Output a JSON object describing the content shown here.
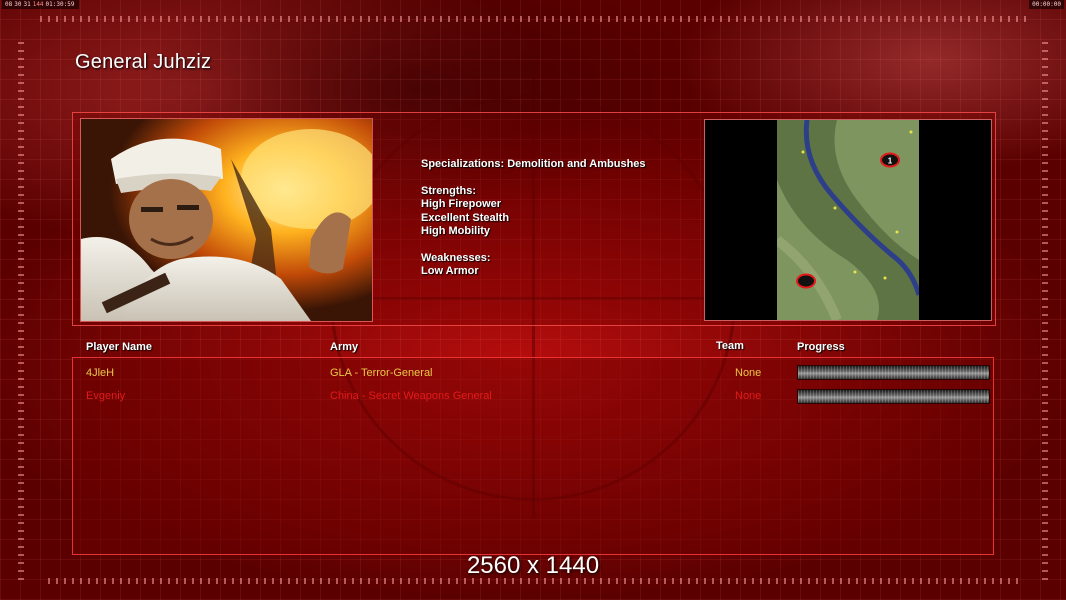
{
  "clock": {
    "left_segments": [
      "08",
      "30",
      "31",
      "144",
      "01:30:59"
    ],
    "right": "00:00:00"
  },
  "title": "General Juhziz",
  "briefing": {
    "specializations": "Specializations: Demolition and Ambushes",
    "strengths_header": "Strengths:",
    "strengths": [
      "High Firepower",
      "Excellent Stealth",
      "High Mobility"
    ],
    "weaknesses_header": "Weaknesses:",
    "weaknesses": [
      "Low Armor"
    ]
  },
  "minimap": {
    "start_markers": [
      {
        "label": "1"
      },
      {
        "label": ""
      }
    ]
  },
  "table": {
    "headers": {
      "player_name": "Player Name",
      "army": "Army",
      "team": "Team",
      "progress": "Progress"
    },
    "rows": [
      {
        "player": "4JleH",
        "army": "GLA - Terror-General",
        "team": "None",
        "progress": 0,
        "color": "#e8c84a"
      },
      {
        "player": "Evgeniy",
        "army": "China - Secret Weapons General",
        "team": "None",
        "progress": 0,
        "color": "#e31b1b"
      }
    ]
  },
  "overlay": {
    "resolution": "2560 x 1440"
  },
  "colors": {
    "accent_red": "#d01010",
    "player1": "#e8c84a",
    "player2": "#e31b1b"
  }
}
